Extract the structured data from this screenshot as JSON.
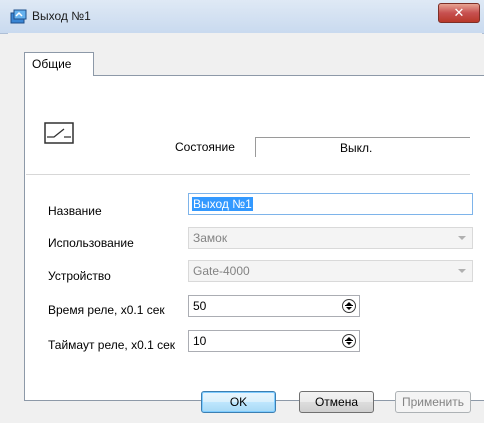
{
  "window": {
    "title": "Выход №1",
    "close_glyph": "✕"
  },
  "tabs": [
    {
      "label": "Общие"
    }
  ],
  "state": {
    "label": "Состояние",
    "value": "Выкл.",
    "icon": "switch-open-icon"
  },
  "form": {
    "name": {
      "label": "Название",
      "value": "Выход №1"
    },
    "usage": {
      "label": "Использование",
      "value": "Замок"
    },
    "device": {
      "label": "Устройство",
      "value": "Gate-4000"
    },
    "relay_time": {
      "label": "Время реле, x0.1 сек",
      "value": "50"
    },
    "relay_timeout": {
      "label": "Таймаут реле, x0.1 сек",
      "value": "10"
    }
  },
  "buttons": {
    "ok": "OK",
    "cancel": "Отмена",
    "apply": "Применить"
  },
  "colors": {
    "selection": "#3399ff",
    "close_button": "#c75050"
  }
}
